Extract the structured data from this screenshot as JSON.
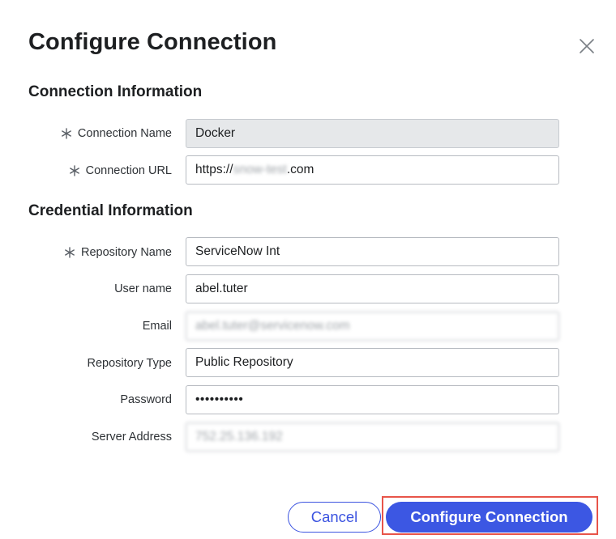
{
  "dialog": {
    "title": "Configure Connection",
    "close_icon": "close-icon"
  },
  "connection_section": {
    "title": "Connection Information",
    "connection_name": {
      "label": "Connection Name",
      "value": "Docker",
      "required": true
    },
    "connection_url": {
      "label": "Connection URL",
      "prefix": "https://",
      "redacted": "snow-test",
      "suffix": ".com",
      "required": true
    }
  },
  "credential_section": {
    "title": "Credential Information",
    "repository_name": {
      "label": "Repository Name",
      "value": "ServiceNow Int",
      "required": true
    },
    "user_name": {
      "label": "User name",
      "value": "abel.tuter"
    },
    "email": {
      "label": "Email",
      "value": "abel.tuter@servicenow.com"
    },
    "repository_type": {
      "label": "Repository Type",
      "value": "Public Repository"
    },
    "password": {
      "label": "Password",
      "value": "••••••••••"
    },
    "server_address": {
      "label": "Server Address",
      "value": "752.25.136.192"
    }
  },
  "footer": {
    "cancel_label": "Cancel",
    "confirm_label": "Configure Connection"
  },
  "colors": {
    "accent": "#3c57e3",
    "highlight_outline": "#e8554a",
    "readonly_field": "#e6e8ea"
  }
}
